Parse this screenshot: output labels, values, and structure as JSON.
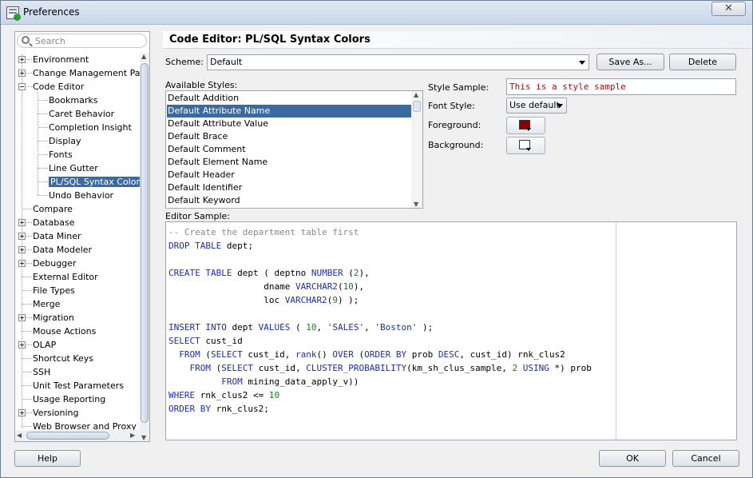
{
  "window": {
    "title": "Preferences",
    "close": "✕"
  },
  "search": {
    "placeholder": "Search"
  },
  "tree": [
    {
      "label": "Environment",
      "level": 0,
      "expander": "plus"
    },
    {
      "label": "Change Management Parar",
      "level": 0,
      "expander": "plus"
    },
    {
      "label": "Code Editor",
      "level": 0,
      "expander": "minus"
    },
    {
      "label": "Bookmarks",
      "level": 1
    },
    {
      "label": "Caret Behavior",
      "level": 1
    },
    {
      "label": "Completion Insight",
      "level": 1
    },
    {
      "label": "Display",
      "level": 1
    },
    {
      "label": "Fonts",
      "level": 1
    },
    {
      "label": "Line Gutter",
      "level": 1
    },
    {
      "label": "PL/SQL Syntax Colors",
      "level": 1,
      "selected": true
    },
    {
      "label": "Undo Behavior",
      "level": 1
    },
    {
      "label": "Compare",
      "level": 0
    },
    {
      "label": "Database",
      "level": 0,
      "expander": "plus"
    },
    {
      "label": "Data Miner",
      "level": 0,
      "expander": "plus"
    },
    {
      "label": "Data Modeler",
      "level": 0,
      "expander": "plus"
    },
    {
      "label": "Debugger",
      "level": 0,
      "expander": "plus"
    },
    {
      "label": "External Editor",
      "level": 0
    },
    {
      "label": "File Types",
      "level": 0
    },
    {
      "label": "Merge",
      "level": 0
    },
    {
      "label": "Migration",
      "level": 0,
      "expander": "plus"
    },
    {
      "label": "Mouse Actions",
      "level": 0
    },
    {
      "label": "OLAP",
      "level": 0,
      "expander": "plus"
    },
    {
      "label": "Shortcut Keys",
      "level": 0
    },
    {
      "label": "SSH",
      "level": 0
    },
    {
      "label": "Unit Test Parameters",
      "level": 0
    },
    {
      "label": "Usage Reporting",
      "level": 0
    },
    {
      "label": "Versioning",
      "level": 0,
      "expander": "plus"
    },
    {
      "label": "Web Browser and Proxy",
      "level": 0
    }
  ],
  "panel": {
    "title": "Code Editor: PL/SQL Syntax Colors",
    "scheme_label": "Scheme:",
    "scheme_value": "Default",
    "save_as": "Save As...",
    "delete": "Delete",
    "available_label": "Available Styles:",
    "styles": [
      "Default Addition",
      "Default Attribute Name",
      "Default Attribute Value",
      "Default Brace",
      "Default Comment",
      "Default Element Name",
      "Default Header",
      "Default Identifier",
      "Default Keyword"
    ],
    "selected_style": "Default Attribute Name",
    "style_sample_label": "Style Sample:",
    "style_sample_text": "This is a style sample",
    "font_style_label": "Font Style:",
    "font_style_value": "Use default",
    "foreground_label": "Foreground:",
    "foreground_color": "#8b0000",
    "background_label": "Background:",
    "background_color": "#ffffff",
    "editor_sample_label": "Editor Sample:"
  },
  "code_lines": [
    [
      {
        "t": "-- Create the department table first",
        "c": "cm"
      }
    ],
    [
      {
        "t": "DROP TABLE",
        "c": "kw"
      },
      {
        "t": " dept;"
      }
    ],
    [
      {
        "t": ""
      }
    ],
    [
      {
        "t": "CREATE TABLE",
        "c": "kw"
      },
      {
        "t": " dept ( deptno "
      },
      {
        "t": "NUMBER",
        "c": "ty"
      },
      {
        "t": " ("
      },
      {
        "t": "2",
        "c": "nu"
      },
      {
        "t": "),"
      }
    ],
    [
      {
        "t": "                  dname "
      },
      {
        "t": "VARCHAR2",
        "c": "ty"
      },
      {
        "t": "("
      },
      {
        "t": "10",
        "c": "nu"
      },
      {
        "t": "),"
      }
    ],
    [
      {
        "t": "                  loc "
      },
      {
        "t": "VARCHAR2",
        "c": "ty"
      },
      {
        "t": "("
      },
      {
        "t": "9",
        "c": "nu"
      },
      {
        "t": ") );"
      }
    ],
    [
      {
        "t": ""
      }
    ],
    [
      {
        "t": "INSERT INTO",
        "c": "kw"
      },
      {
        "t": " dept "
      },
      {
        "t": "VALUES",
        "c": "kw"
      },
      {
        "t": " ( "
      },
      {
        "t": "10",
        "c": "nu"
      },
      {
        "t": ", "
      },
      {
        "t": "'SALES'",
        "c": "st"
      },
      {
        "t": ", "
      },
      {
        "t": "'Boston'",
        "c": "st"
      },
      {
        "t": " );"
      }
    ],
    [
      {
        "t": "SELECT",
        "c": "kw"
      },
      {
        "t": " cust_id"
      }
    ],
    [
      {
        "t": "  "
      },
      {
        "t": "FROM",
        "c": "kw"
      },
      {
        "t": " ("
      },
      {
        "t": "SELECT",
        "c": "kw"
      },
      {
        "t": " cust_id, "
      },
      {
        "t": "rank",
        "c": "fn"
      },
      {
        "t": "() "
      },
      {
        "t": "OVER",
        "c": "kw"
      },
      {
        "t": " ("
      },
      {
        "t": "ORDER BY",
        "c": "kw"
      },
      {
        "t": " prob "
      },
      {
        "t": "DESC",
        "c": "kw"
      },
      {
        "t": ", cust_id) rnk_clus2"
      }
    ],
    [
      {
        "t": "    "
      },
      {
        "t": "FROM",
        "c": "kw"
      },
      {
        "t": " ("
      },
      {
        "t": "SELECT",
        "c": "kw"
      },
      {
        "t": " cust_id, "
      },
      {
        "t": "CLUSTER_PROBABILITY",
        "c": "fn"
      },
      {
        "t": "(km_sh_clus_sample, "
      },
      {
        "t": "2",
        "c": "nu"
      },
      {
        "t": " "
      },
      {
        "t": "USING",
        "c": "kw"
      },
      {
        "t": " *) prob"
      }
    ],
    [
      {
        "t": "          "
      },
      {
        "t": "FROM",
        "c": "kw"
      },
      {
        "t": " mining_data_apply_v))"
      }
    ],
    [
      {
        "t": "WHERE",
        "c": "kw"
      },
      {
        "t": " rnk_clus2 <= "
      },
      {
        "t": "10",
        "c": "nu"
      }
    ],
    [
      {
        "t": "ORDER BY",
        "c": "kw"
      },
      {
        "t": " rnk_clus2;"
      }
    ]
  ],
  "footer": {
    "help": "Help",
    "ok": "OK",
    "cancel": "Cancel"
  }
}
